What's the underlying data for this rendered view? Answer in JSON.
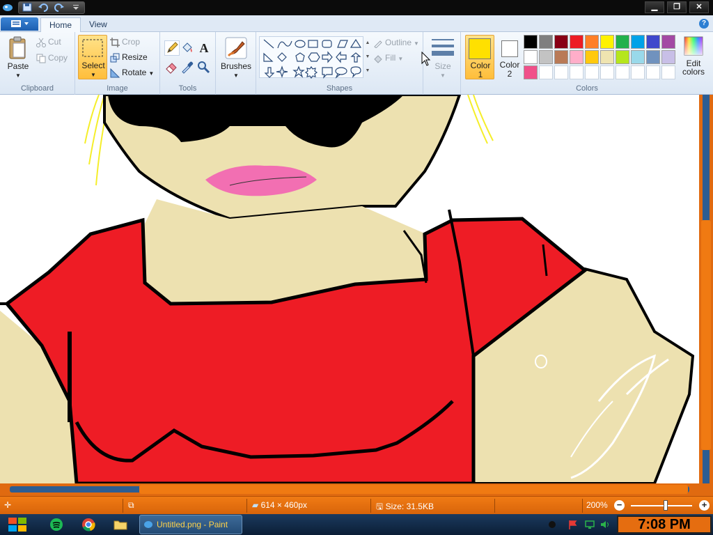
{
  "app": {
    "window_title": "Untitled.png - Paint"
  },
  "quick_access": {
    "save_icon": "save-icon",
    "undo_icon": "undo-icon",
    "redo_icon": "redo-icon",
    "customize_icon": "dropdown-icon"
  },
  "window_controls": {
    "minimize": "minimize-icon",
    "maximize": "maximize-icon",
    "close": "close-icon"
  },
  "tabs": {
    "file_icon": "paint-menu-icon",
    "home": "Home",
    "view": "View"
  },
  "ribbon": {
    "clipboard": {
      "label": "Clipboard",
      "paste": "Paste",
      "cut": "Cut",
      "copy": "Copy"
    },
    "image": {
      "label": "Image",
      "select": "Select",
      "crop": "Crop",
      "resize": "Resize",
      "rotate": "Rotate"
    },
    "tools": {
      "label": "Tools"
    },
    "brushes": {
      "label": "Brushes"
    },
    "shapes": {
      "label": "Shapes",
      "outline": "Outline",
      "fill": "Fill"
    },
    "size": {
      "label": "Size"
    },
    "colors": {
      "label": "Colors",
      "color1_label": "Color",
      "color1_num": "1",
      "color2_label": "Color",
      "color2_num": "2",
      "edit_label": "Edit",
      "edit_label2": "colors",
      "color1_value": "#ffe000",
      "color2_value": "#ffffff",
      "palette_row1": [
        "#000000",
        "#7f7f7f",
        "#880015",
        "#ed1c24",
        "#ff7f27",
        "#fff200",
        "#22b14c",
        "#00a2e8",
        "#3f48cc",
        "#a349a4"
      ],
      "palette_row2": [
        "#ffffff",
        "#c3c3c3",
        "#b97a57",
        "#ffaec9",
        "#ffc90e",
        "#efe4b0",
        "#b5e61d",
        "#99d9ea",
        "#7092be",
        "#c8bfe7"
      ],
      "palette_row3": [
        "#f0508a"
      ]
    }
  },
  "status": {
    "dimensions": "614 × 460px",
    "size": "Size: 31.5KB",
    "zoom": "200%"
  },
  "taskbar": {
    "task_label": "Untitled.png - Paint",
    "clock": "7:08 PM"
  },
  "drawing": {
    "skin": "#ede1b0",
    "shirt": "#ee1c25",
    "lips": "#f26fb2",
    "hair": "#f5ee2a",
    "outline": "#000000"
  }
}
